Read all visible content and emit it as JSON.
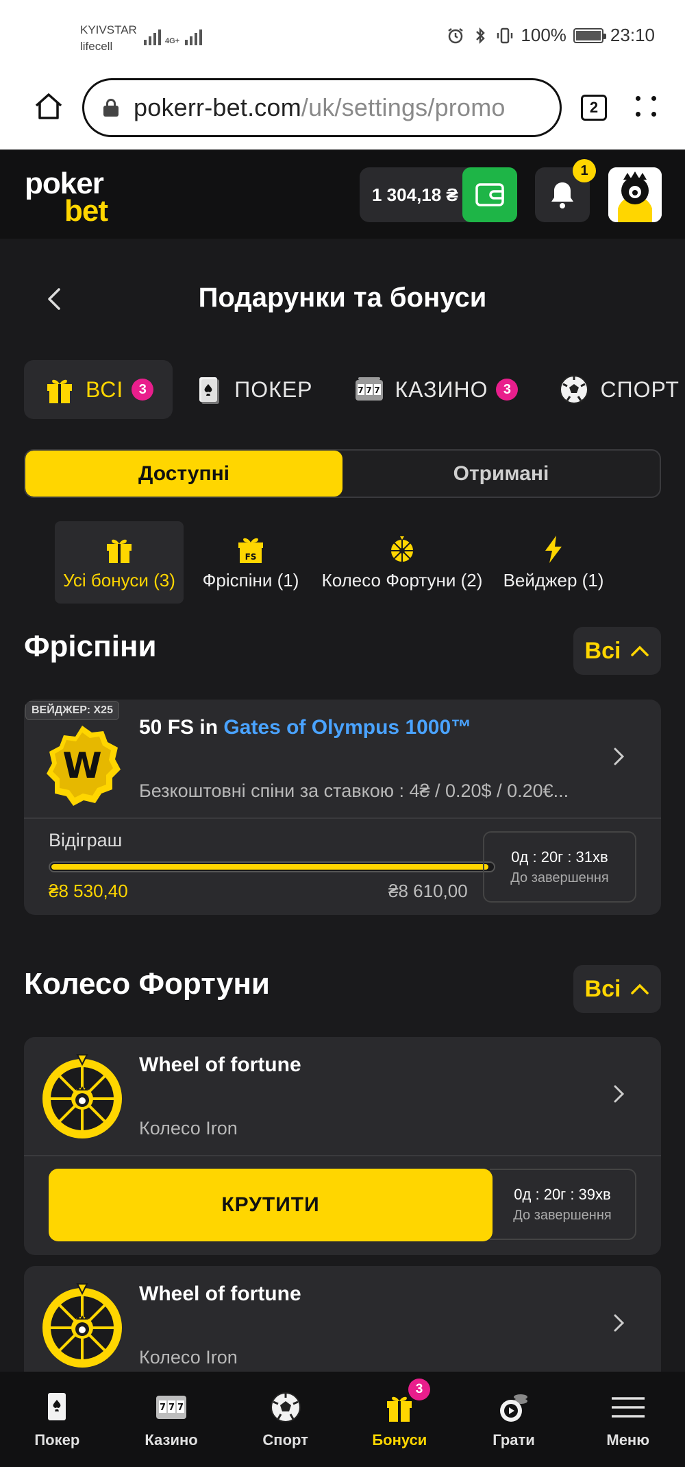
{
  "status_bar": {
    "carrier1": "KYIVSTAR",
    "carrier2": "lifecell",
    "network": "4G+",
    "battery": "100%",
    "time": "23:10"
  },
  "browser": {
    "url_domain": "pokerr-bet.com",
    "url_path": "/uk/settings/promo",
    "tab_count": "2"
  },
  "header": {
    "logo_line1": "poker",
    "logo_line2": "bet",
    "balance": "1 304,18 ₴",
    "notifications_count": "1",
    "icons": {
      "wallet": "wallet-icon",
      "bell": "bell-icon",
      "avatar": "avatar"
    }
  },
  "page": {
    "title": "Подарунки та бонуси"
  },
  "category_tabs": [
    {
      "label": "ВСІ",
      "badge": "3",
      "icon": "gift-icon",
      "active": true
    },
    {
      "label": "ПОКЕР",
      "badge": "",
      "icon": "card-icon",
      "active": false
    },
    {
      "label": "КАЗИНО",
      "badge": "3",
      "icon": "slot-icon",
      "active": false
    },
    {
      "label": "СПОРТ",
      "badge": "",
      "icon": "football-icon",
      "active": false
    }
  ],
  "segment": {
    "available": "Доступні",
    "received": "Отримані",
    "selected": "available"
  },
  "sub_tabs": [
    {
      "label": "Усі бонуси (3)",
      "icon": "gift-icon",
      "active": true
    },
    {
      "label": "Фріспіни (1)",
      "icon": "freespin-gift-icon",
      "active": false
    },
    {
      "label": "Колесо Фортуни (2)",
      "icon": "wheel-icon",
      "active": false
    },
    {
      "label": "Вейджер (1)",
      "icon": "lightning-icon",
      "active": false
    }
  ],
  "freespins_section": {
    "title": "Фріспіни",
    "toggle_label": "Всі",
    "card": {
      "wager_tag": "ВЕЙДЖЕР: X25",
      "title_prefix": "50 FS in ",
      "title_link": "Gates of Olympus 1000™",
      "subtitle": "Безкоштовні спіни за ставкою : 4₴ / 0.20$ / 0.20€...",
      "wagering_label": "Відіграш",
      "wagering_current": "₴8 530,40",
      "wagering_target": "₴8 610,00",
      "progress_fraction": 0.9908,
      "timer": "0д : 20г : 31хв",
      "timer_caption": "До завершення"
    }
  },
  "wheel_section": {
    "title": "Колесо Фортуни",
    "toggle_label": "Всі",
    "cards": [
      {
        "title": "Wheel of fortune",
        "subtitle": "Колесо Iron",
        "spin_label": "КРУТИТИ",
        "timer": "0д : 20г : 39хв",
        "timer_caption": "До завершення"
      },
      {
        "title": "Wheel of fortune",
        "subtitle": "Колесо Iron"
      }
    ]
  },
  "bottom_nav": [
    {
      "label": "Покер",
      "icon": "poker-card-icon",
      "badge": "",
      "active": false
    },
    {
      "label": "Казино",
      "icon": "slot-machine-icon",
      "badge": "",
      "active": false
    },
    {
      "label": "Спорт",
      "icon": "football-icon",
      "badge": "",
      "active": false
    },
    {
      "label": "Бонуси",
      "icon": "gift-icon",
      "badge": "3",
      "active": true
    },
    {
      "label": "Грати",
      "icon": "play-chips-icon",
      "badge": "",
      "active": false
    },
    {
      "label": "Меню",
      "icon": "hamburger-icon",
      "badge": "",
      "active": false
    }
  ],
  "colors": {
    "accent": "#ffd600",
    "badge": "#e91e8c",
    "link": "#4aa3ff",
    "wallet_green": "#1eb547",
    "background": "#1a1a1c",
    "card": "#2a2a2d"
  }
}
